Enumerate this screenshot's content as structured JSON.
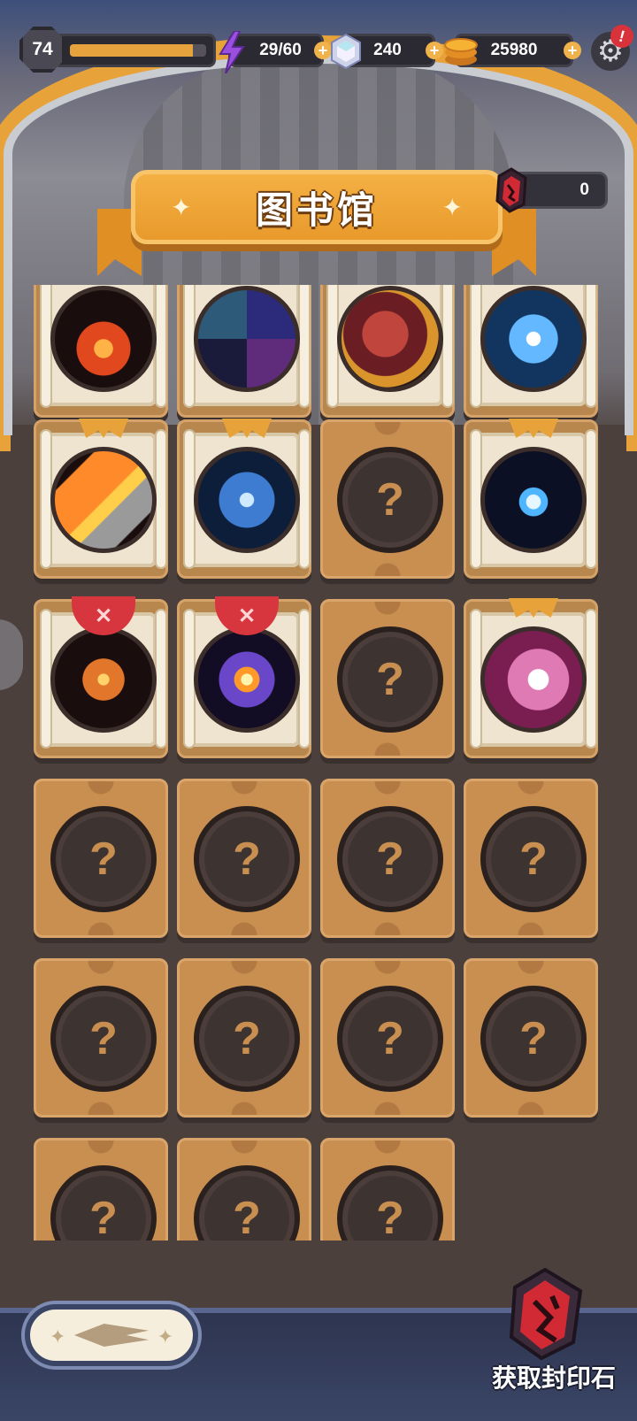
{
  "hud": {
    "level": "74",
    "xp_progress": 0.9,
    "energy": "29/60",
    "gems": "240",
    "coins": "25980",
    "plus": "+",
    "alert": "!"
  },
  "title": {
    "text": "图书馆"
  },
  "seal_counter": {
    "value": "0"
  },
  "grid": {
    "question_mark": "?",
    "cards": [
      {
        "state": "unlocked",
        "art": "flame-claw",
        "badge": "none"
      },
      {
        "state": "unlocked",
        "art": "chaos-symbols",
        "badge": "none"
      },
      {
        "state": "unlocked",
        "art": "red-beast",
        "badge": "none"
      },
      {
        "state": "unlocked",
        "art": "chained-dove",
        "badge": "none"
      },
      {
        "state": "unlocked",
        "art": "fire-gauntlet",
        "badge": "crown"
      },
      {
        "state": "unlocked",
        "art": "ice-blades",
        "badge": "crown"
      },
      {
        "state": "locked"
      },
      {
        "state": "unlocked",
        "art": "lightning-orb",
        "badge": "crown"
      },
      {
        "state": "unlocked",
        "art": "fire-vortex",
        "badge": "seal"
      },
      {
        "state": "unlocked",
        "art": "galaxy-sun",
        "badge": "seal"
      },
      {
        "state": "locked"
      },
      {
        "state": "unlocked",
        "art": "spirit-fox",
        "badge": "crown"
      },
      {
        "state": "locked"
      },
      {
        "state": "locked"
      },
      {
        "state": "locked"
      },
      {
        "state": "locked"
      },
      {
        "state": "locked"
      },
      {
        "state": "locked"
      },
      {
        "state": "locked"
      },
      {
        "state": "locked"
      },
      {
        "state": "locked"
      },
      {
        "state": "locked"
      },
      {
        "state": "locked"
      }
    ]
  },
  "bottom": {
    "seal_stone_label": "获取封印石"
  },
  "colors": {
    "accent": "#e99a2c",
    "card": "#c98f51",
    "seal_red": "#d8363f"
  }
}
